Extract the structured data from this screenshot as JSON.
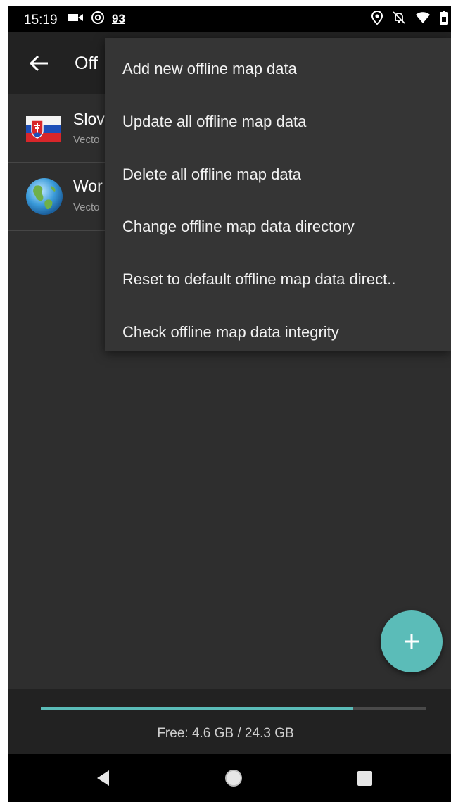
{
  "status_bar": {
    "time": "15:19",
    "notification_number": "93",
    "icons": [
      "video-camera-icon",
      "at-sign-icon",
      "location-icon",
      "notifications-off-icon",
      "wifi-icon",
      "battery-icon"
    ]
  },
  "app_bar": {
    "back_icon": "arrow-left-icon",
    "title": "Off"
  },
  "list": {
    "items": [
      {
        "title": "Slov",
        "subtitle": "Vecto",
        "icon": "slovakia-flag-icon"
      },
      {
        "title": "Wor",
        "subtitle": "Vecto",
        "icon": "globe-icon"
      }
    ]
  },
  "overflow_menu": {
    "items": [
      "Add new offline map data",
      "Update all offline map data",
      "Delete all offline map data",
      "Change offline map data directory",
      "Reset to default offline map data direct..",
      "Check offline map data integrity"
    ]
  },
  "fab": {
    "icon": "plus-icon"
  },
  "storage": {
    "label": "Free: 4.6 GB / 24.3 GB",
    "used_fraction": 0.81
  },
  "nav_bar": {
    "buttons": [
      "back-triangle-icon",
      "home-circle-icon",
      "recents-square-icon"
    ]
  },
  "colors": {
    "accent": "#5bbcb8",
    "background": "#2e2e2e",
    "app_bar": "#222222",
    "menu": "#353535"
  }
}
